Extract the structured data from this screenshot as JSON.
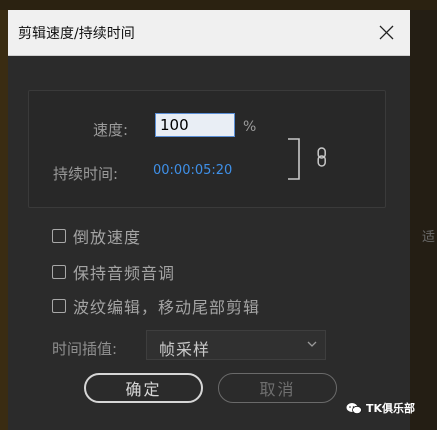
{
  "dialog": {
    "title": "剪辑速度/持续时间",
    "speed_label": "速度:",
    "speed_value": "100",
    "speed_unit": "%",
    "duration_label": "持续时间:",
    "duration_value": "00:00:05:20",
    "options": [
      {
        "label": "倒放速度",
        "checked": false
      },
      {
        "label": "保持音频音调",
        "checked": false
      },
      {
        "label": "波纹编辑，移动尾部剪辑",
        "checked": false
      }
    ],
    "interpolation_label": "时间插值:",
    "interpolation_value": "帧采样",
    "ok_label": "确定",
    "cancel_label": "取消"
  },
  "background": {
    "right_edge_text": "适"
  },
  "watermark": {
    "text": "TK俱乐部"
  },
  "colors": {
    "dialog_bg": "#2b2b2b",
    "titlebar_bg": "#f0f0f0",
    "timecode_blue": "#3f90e8",
    "input_border": "#5b8fd6"
  },
  "icons": [
    "close-icon",
    "link-chain-icon",
    "bracket-icon",
    "chevron-down-icon",
    "wechat-icon"
  ]
}
